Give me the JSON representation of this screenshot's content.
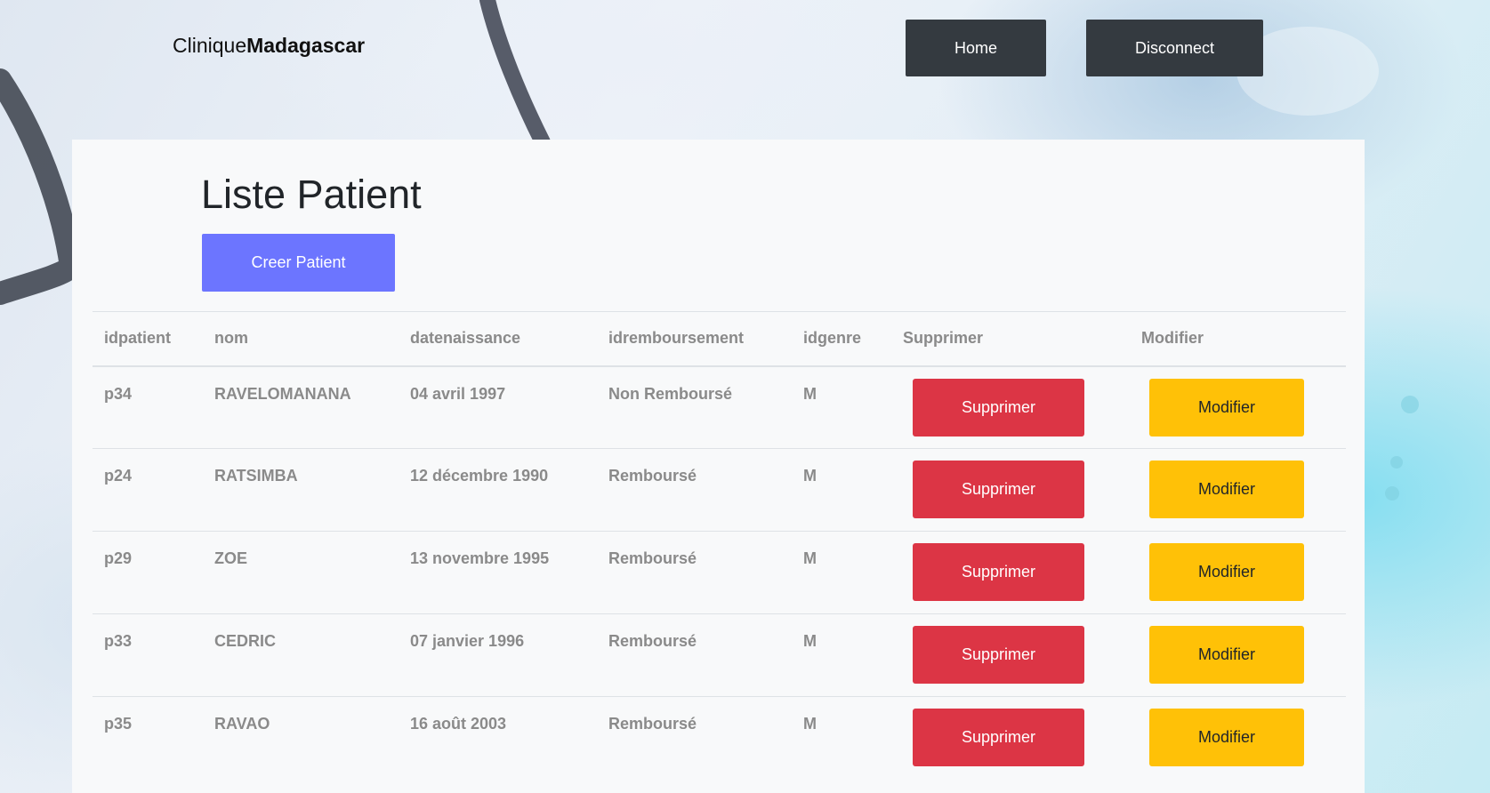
{
  "header": {
    "brand_regular": "Clinique",
    "brand_bold": "Madagascar",
    "home_label": "Home",
    "disconnect_label": "Disconnect"
  },
  "main": {
    "title": "Liste Patient",
    "create_label": "Creer Patient"
  },
  "table": {
    "columns": [
      "idpatient",
      "nom",
      "datenaissance",
      "idremboursement",
      "idgenre",
      "Supprimer",
      "Modifier"
    ],
    "rows": [
      {
        "idpatient": "p34",
        "nom": "RAVELOMANANA",
        "datenaissance": "04 avril 1997",
        "idremboursement": "Non Remboursé",
        "idgenre": "M",
        "delete_label": "Supprimer",
        "edit_label": "Modifier"
      },
      {
        "idpatient": "p24",
        "nom": "RATSIMBA",
        "datenaissance": "12 décembre 1990",
        "idremboursement": "Remboursé",
        "idgenre": "M",
        "delete_label": "Supprimer",
        "edit_label": "Modifier"
      },
      {
        "idpatient": "p29",
        "nom": "ZOE",
        "datenaissance": "13 novembre 1995",
        "idremboursement": "Remboursé",
        "idgenre": "M",
        "delete_label": "Supprimer",
        "edit_label": "Modifier"
      },
      {
        "idpatient": "p33",
        "nom": "CEDRIC",
        "datenaissance": "07 janvier 1996",
        "idremboursement": "Remboursé",
        "idgenre": "M",
        "delete_label": "Supprimer",
        "edit_label": "Modifier"
      },
      {
        "idpatient": "p35",
        "nom": "RAVAO",
        "datenaissance": "16 août 2003",
        "idremboursement": "Remboursé",
        "idgenre": "M",
        "delete_label": "Supprimer",
        "edit_label": "Modifier"
      }
    ]
  },
  "colors": {
    "nav_button": "#343a40",
    "create_button": "#6c75ff",
    "delete_button": "#dc3545",
    "edit_button": "#ffc107",
    "panel_background": "#f8f9fa"
  }
}
